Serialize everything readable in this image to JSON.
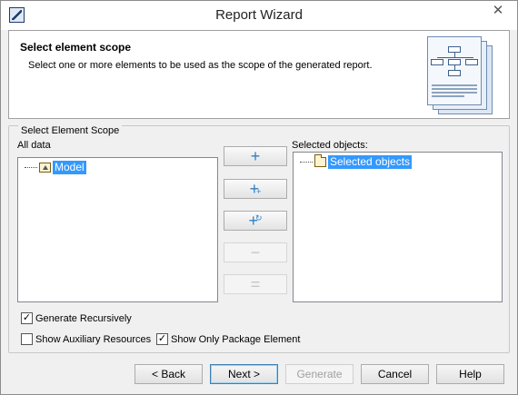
{
  "window": {
    "title": "Report Wizard",
    "close_glyph": "✕"
  },
  "header": {
    "title": "Select element scope",
    "description": "Select one or more elements to be used as the scope of the generated report."
  },
  "group": {
    "legend": "Select Element Scope",
    "all_data_label": "All data",
    "selected_label": "Selected objects:",
    "all_data_tree": [
      {
        "label": "Model",
        "icon": "model-package-icon"
      }
    ],
    "selected_tree": [
      {
        "label": "Selected objects",
        "icon": "folder-icon"
      }
    ]
  },
  "mid_buttons": [
    {
      "name": "add-button",
      "glyph": "+",
      "enabled": true
    },
    {
      "name": "add-recursive-button",
      "glyph": "+",
      "enabled": true
    },
    {
      "name": "add-nested-button",
      "glyph": "+",
      "enabled": true
    },
    {
      "name": "remove-button",
      "glyph": "−",
      "enabled": false
    },
    {
      "name": "remove-all-button",
      "glyph": "=",
      "enabled": false
    }
  ],
  "options": {
    "generate_recursively": {
      "label": "Generate Recursively",
      "checked": true
    },
    "show_auxiliary": {
      "label": "Show Auxiliary Resources",
      "checked": false
    },
    "show_only_package": {
      "label": "Show Only Package Element",
      "checked": true
    }
  },
  "footer": {
    "back": "< Back",
    "next": "Next >",
    "generate": "Generate",
    "cancel": "Cancel",
    "help": "Help"
  },
  "colors": {
    "selection": "#3399ff",
    "accent": "#2d7fc6"
  }
}
